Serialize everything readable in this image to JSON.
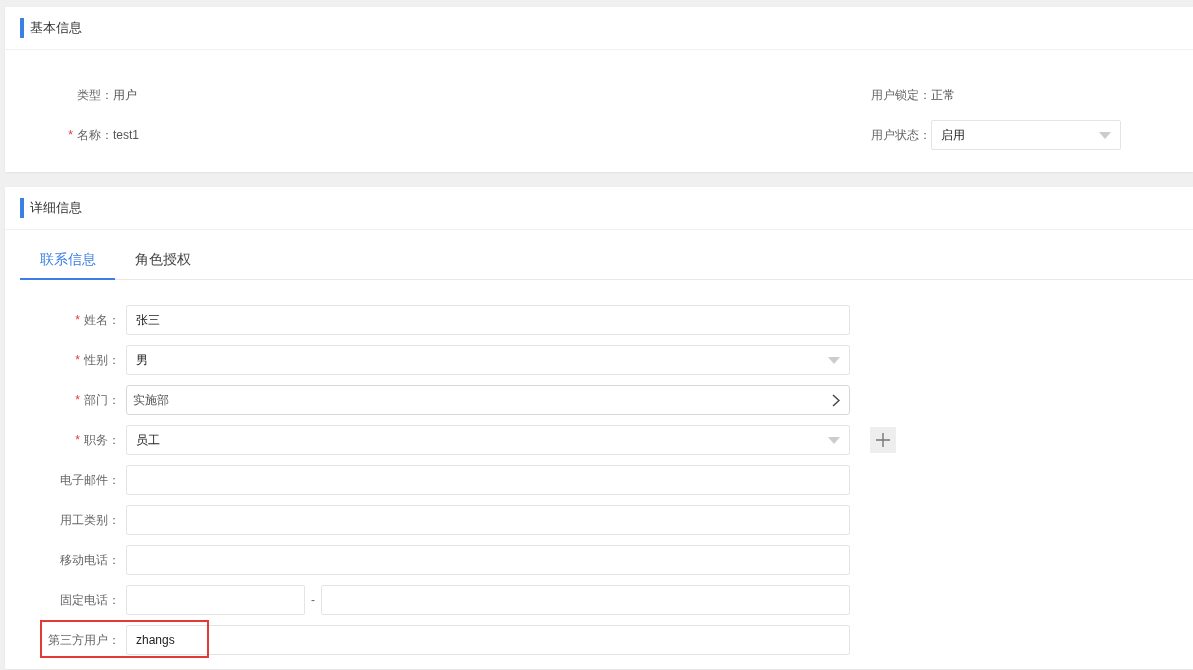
{
  "basic_info": {
    "title": "基本信息",
    "rows": [
      {
        "left": {
          "label": "类型：",
          "value": "用户"
        },
        "right": {
          "label": "用户锁定：",
          "value": "正常",
          "kind": "text"
        }
      },
      {
        "left": {
          "label": "名称：",
          "value": "test1",
          "required_mark": "*"
        },
        "right": {
          "label": "用户状态：",
          "value": "启用",
          "kind": "select"
        }
      }
    ]
  },
  "detail_info": {
    "title": "详细信息",
    "tabs": [
      {
        "label": "联系信息",
        "selected": true
      },
      {
        "label": "角色授权",
        "selected": false
      }
    ],
    "fields": [
      {
        "label": "姓名：",
        "required_mark": "*",
        "kind": "text",
        "value": "张三"
      },
      {
        "label": "性别：",
        "required_mark": "*",
        "kind": "select",
        "value": "男"
      },
      {
        "label": "部门：",
        "required_mark": "*",
        "kind": "picker",
        "value": "实施部"
      },
      {
        "label": "职务：",
        "required_mark": "*",
        "kind": "select",
        "value": "员工",
        "add_button": true
      },
      {
        "label": "电子邮件：",
        "kind": "text"
      },
      {
        "label": "用工类别：",
        "kind": "text"
      },
      {
        "label": "移动电话：",
        "kind": "text"
      },
      {
        "label": "固定电话：",
        "kind": "phone",
        "separator": "-"
      },
      {
        "label": "第三方用户：",
        "kind": "text",
        "value": "zhangs",
        "highlighted": true
      }
    ]
  }
}
